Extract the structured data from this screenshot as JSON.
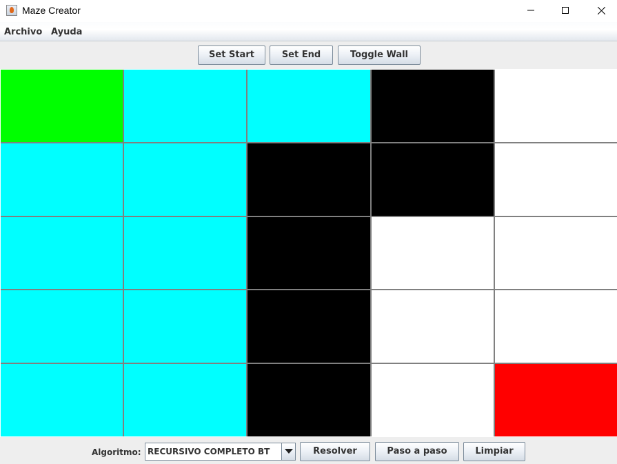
{
  "window": {
    "title": "Maze Creator"
  },
  "menubar": {
    "items": [
      "Archivo",
      "Ayuda"
    ]
  },
  "toolbar": {
    "set_start": "Set Start",
    "set_end": "Set End",
    "toggle_wall": "Toggle Wall"
  },
  "maze": {
    "rows": 5,
    "cols": 5,
    "legend_colors": {
      "start": "#00ff00",
      "end": "#ff0000",
      "wall": "#000000",
      "visited": "#00ffff",
      "empty": "#ffffff"
    },
    "cells": [
      [
        "start",
        "visited",
        "visited",
        "wall",
        "empty"
      ],
      [
        "visited",
        "visited",
        "wall",
        "wall",
        "empty"
      ],
      [
        "visited",
        "visited",
        "wall",
        "empty",
        "empty"
      ],
      [
        "visited",
        "visited",
        "wall",
        "empty",
        "empty"
      ],
      [
        "visited",
        "visited",
        "wall",
        "empty",
        "end"
      ]
    ]
  },
  "bottom": {
    "algorithm_label": "Algoritmo:",
    "algorithm_selected": "RECURSIVO COMPLETO BT",
    "solve": "Resolver",
    "step": "Paso a paso",
    "clear": "Limpiar"
  },
  "icons": {
    "app": "java-coffee-icon",
    "minimize": "minimize-icon",
    "maximize": "maximize-icon",
    "close": "close-icon",
    "dropdown": "chevron-down-icon"
  }
}
